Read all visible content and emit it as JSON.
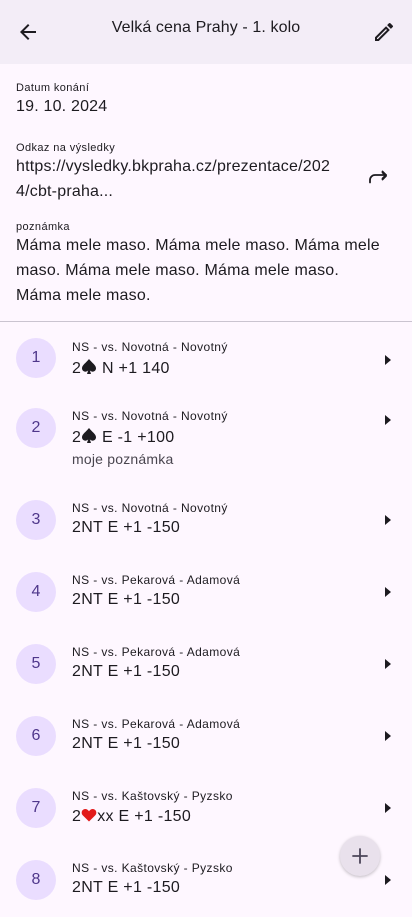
{
  "appbar": {
    "title": "Velká cena Prahy - 1. kolo",
    "back_icon": "arrow-left-icon",
    "edit_icon": "pencil-icon"
  },
  "details": {
    "date_label": "Datum konání",
    "date_value": "19. 10. 2024",
    "link_label": "Odkaz na výsledky",
    "link_line1": "https://vysledky.bkpraha.cz/prezentace/202",
    "link_line2": "4/cbt-praha...",
    "share_icon": "open-link-icon",
    "note_label": "poznámka",
    "note_line1": "Máma mele maso. Máma mele maso. Máma mele",
    "note_line2": "maso. Máma mele maso. Máma mele maso.",
    "note_line3": "Máma mele maso."
  },
  "boards": [
    {
      "number": "1",
      "overline": "NS - vs. Novotná - Novotný",
      "contract_pre": "2",
      "suit": "spade",
      "contract_post": " N +1 140",
      "note": ""
    },
    {
      "number": "2",
      "overline": "NS - vs. Novotná - Novotný",
      "contract_pre": "2",
      "suit": "spade",
      "contract_post": " E -1 +100",
      "note": "moje poznámka"
    },
    {
      "number": "3",
      "overline": "NS - vs. Novotná - Novotný",
      "contract_pre": "2NT E +1 -150",
      "suit": "",
      "contract_post": "",
      "note": ""
    },
    {
      "number": "4",
      "overline": "NS - vs. Pekarová - Adamová",
      "contract_pre": "2NT E +1 -150",
      "suit": "",
      "contract_post": "",
      "note": ""
    },
    {
      "number": "5",
      "overline": "NS - vs. Pekarová - Adamová",
      "contract_pre": "2NT E +1 -150",
      "suit": "",
      "contract_post": "",
      "note": ""
    },
    {
      "number": "6",
      "overline": "NS - vs. Pekarová - Adamová",
      "contract_pre": "2NT E +1 -150",
      "suit": "",
      "contract_post": "",
      "note": ""
    },
    {
      "number": "7",
      "overline": "NS - vs. Kaštovský - Pyzsko",
      "contract_pre": "2",
      "suit": "heart",
      "contract_post": "xx E +1 -150",
      "note": ""
    },
    {
      "number": "8",
      "overline": "NS - vs. Kaštovský - Pyzsko",
      "contract_pre": "2NT E +1 -150",
      "suit": "",
      "contract_post": "",
      "note": ""
    }
  ],
  "fab": {
    "icon": "plus-icon"
  },
  "colors": {
    "background": "#fef7ff",
    "appbar": "#f3edf7",
    "badge_bg": "#eaddff",
    "badge_text": "#4f378b",
    "heart": "#e21b1b"
  }
}
